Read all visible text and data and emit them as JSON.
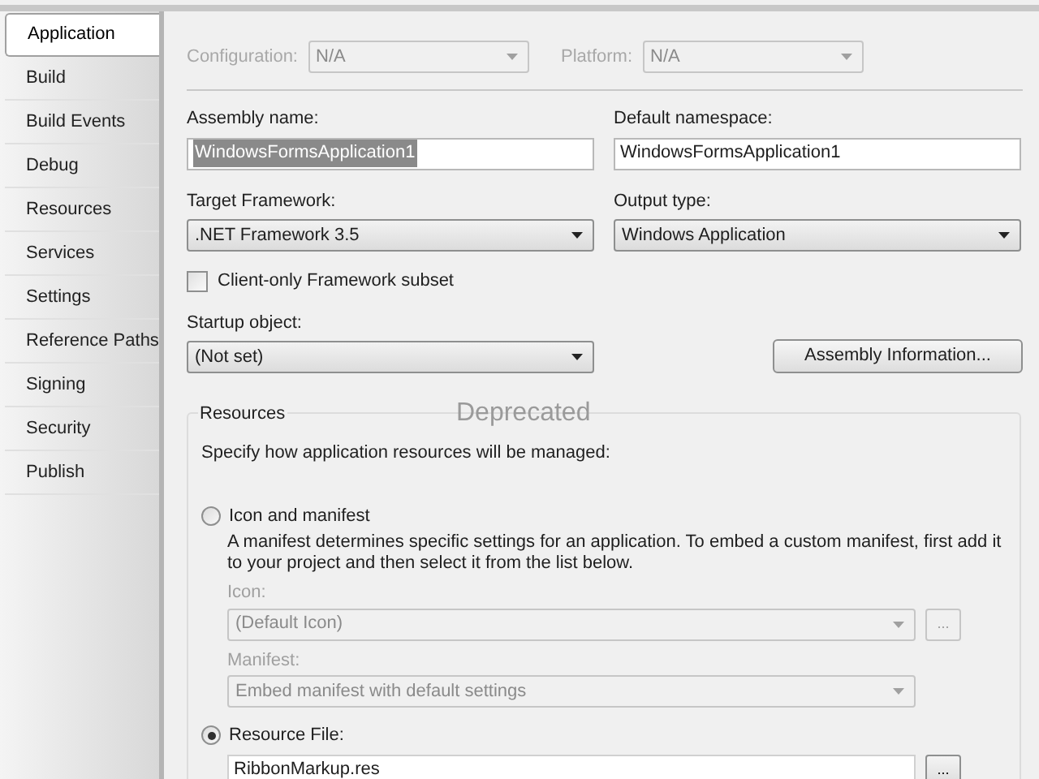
{
  "tabs": [
    {
      "label": "Application",
      "selected": true
    },
    {
      "label": "Build",
      "selected": false
    },
    {
      "label": "Build Events",
      "selected": false
    },
    {
      "label": "Debug",
      "selected": false
    },
    {
      "label": "Resources",
      "selected": false
    },
    {
      "label": "Services",
      "selected": false
    },
    {
      "label": "Settings",
      "selected": false
    },
    {
      "label": "Reference Paths",
      "selected": false
    },
    {
      "label": "Signing",
      "selected": false
    },
    {
      "label": "Security",
      "selected": false
    },
    {
      "label": "Publish",
      "selected": false
    }
  ],
  "configuration": {
    "label": "Configuration:",
    "value": "N/A",
    "disabled": true
  },
  "platform": {
    "label": "Platform:",
    "value": "N/A",
    "disabled": true
  },
  "assembly_name": {
    "label": "Assembly name:",
    "value": "WindowsFormsApplication1",
    "text_selected": true
  },
  "default_namespace": {
    "label": "Default namespace:",
    "value": "WindowsFormsApplication1"
  },
  "target_framework": {
    "label": "Target Framework:",
    "value": ".NET Framework 3.5"
  },
  "output_type": {
    "label": "Output type:",
    "value": "Windows Application"
  },
  "client_only": {
    "label": "Client-only Framework subset",
    "checked": false
  },
  "startup_object": {
    "label": "Startup object:",
    "value": "(Not set)"
  },
  "assembly_information_button": "Assembly Information...",
  "resources": {
    "title": "Resources",
    "overlay_text": "Deprecated",
    "description": "Specify how application resources will be managed:",
    "options": [
      {
        "kind": "icon_manifest",
        "label": "Icon and manifest",
        "selected": false,
        "help": "A manifest determines specific settings for an application. To embed a custom manifest, first add it to your project and then select it from the list below.",
        "icon": {
          "label": "Icon:",
          "value": "(Default Icon)"
        },
        "manifest": {
          "label": "Manifest:",
          "value": "Embed manifest with default settings"
        },
        "browse": "..."
      },
      {
        "kind": "resource_file",
        "label": "Resource File:",
        "selected": true,
        "value": "RibbonMarkup.res",
        "browse": "..."
      }
    ]
  }
}
